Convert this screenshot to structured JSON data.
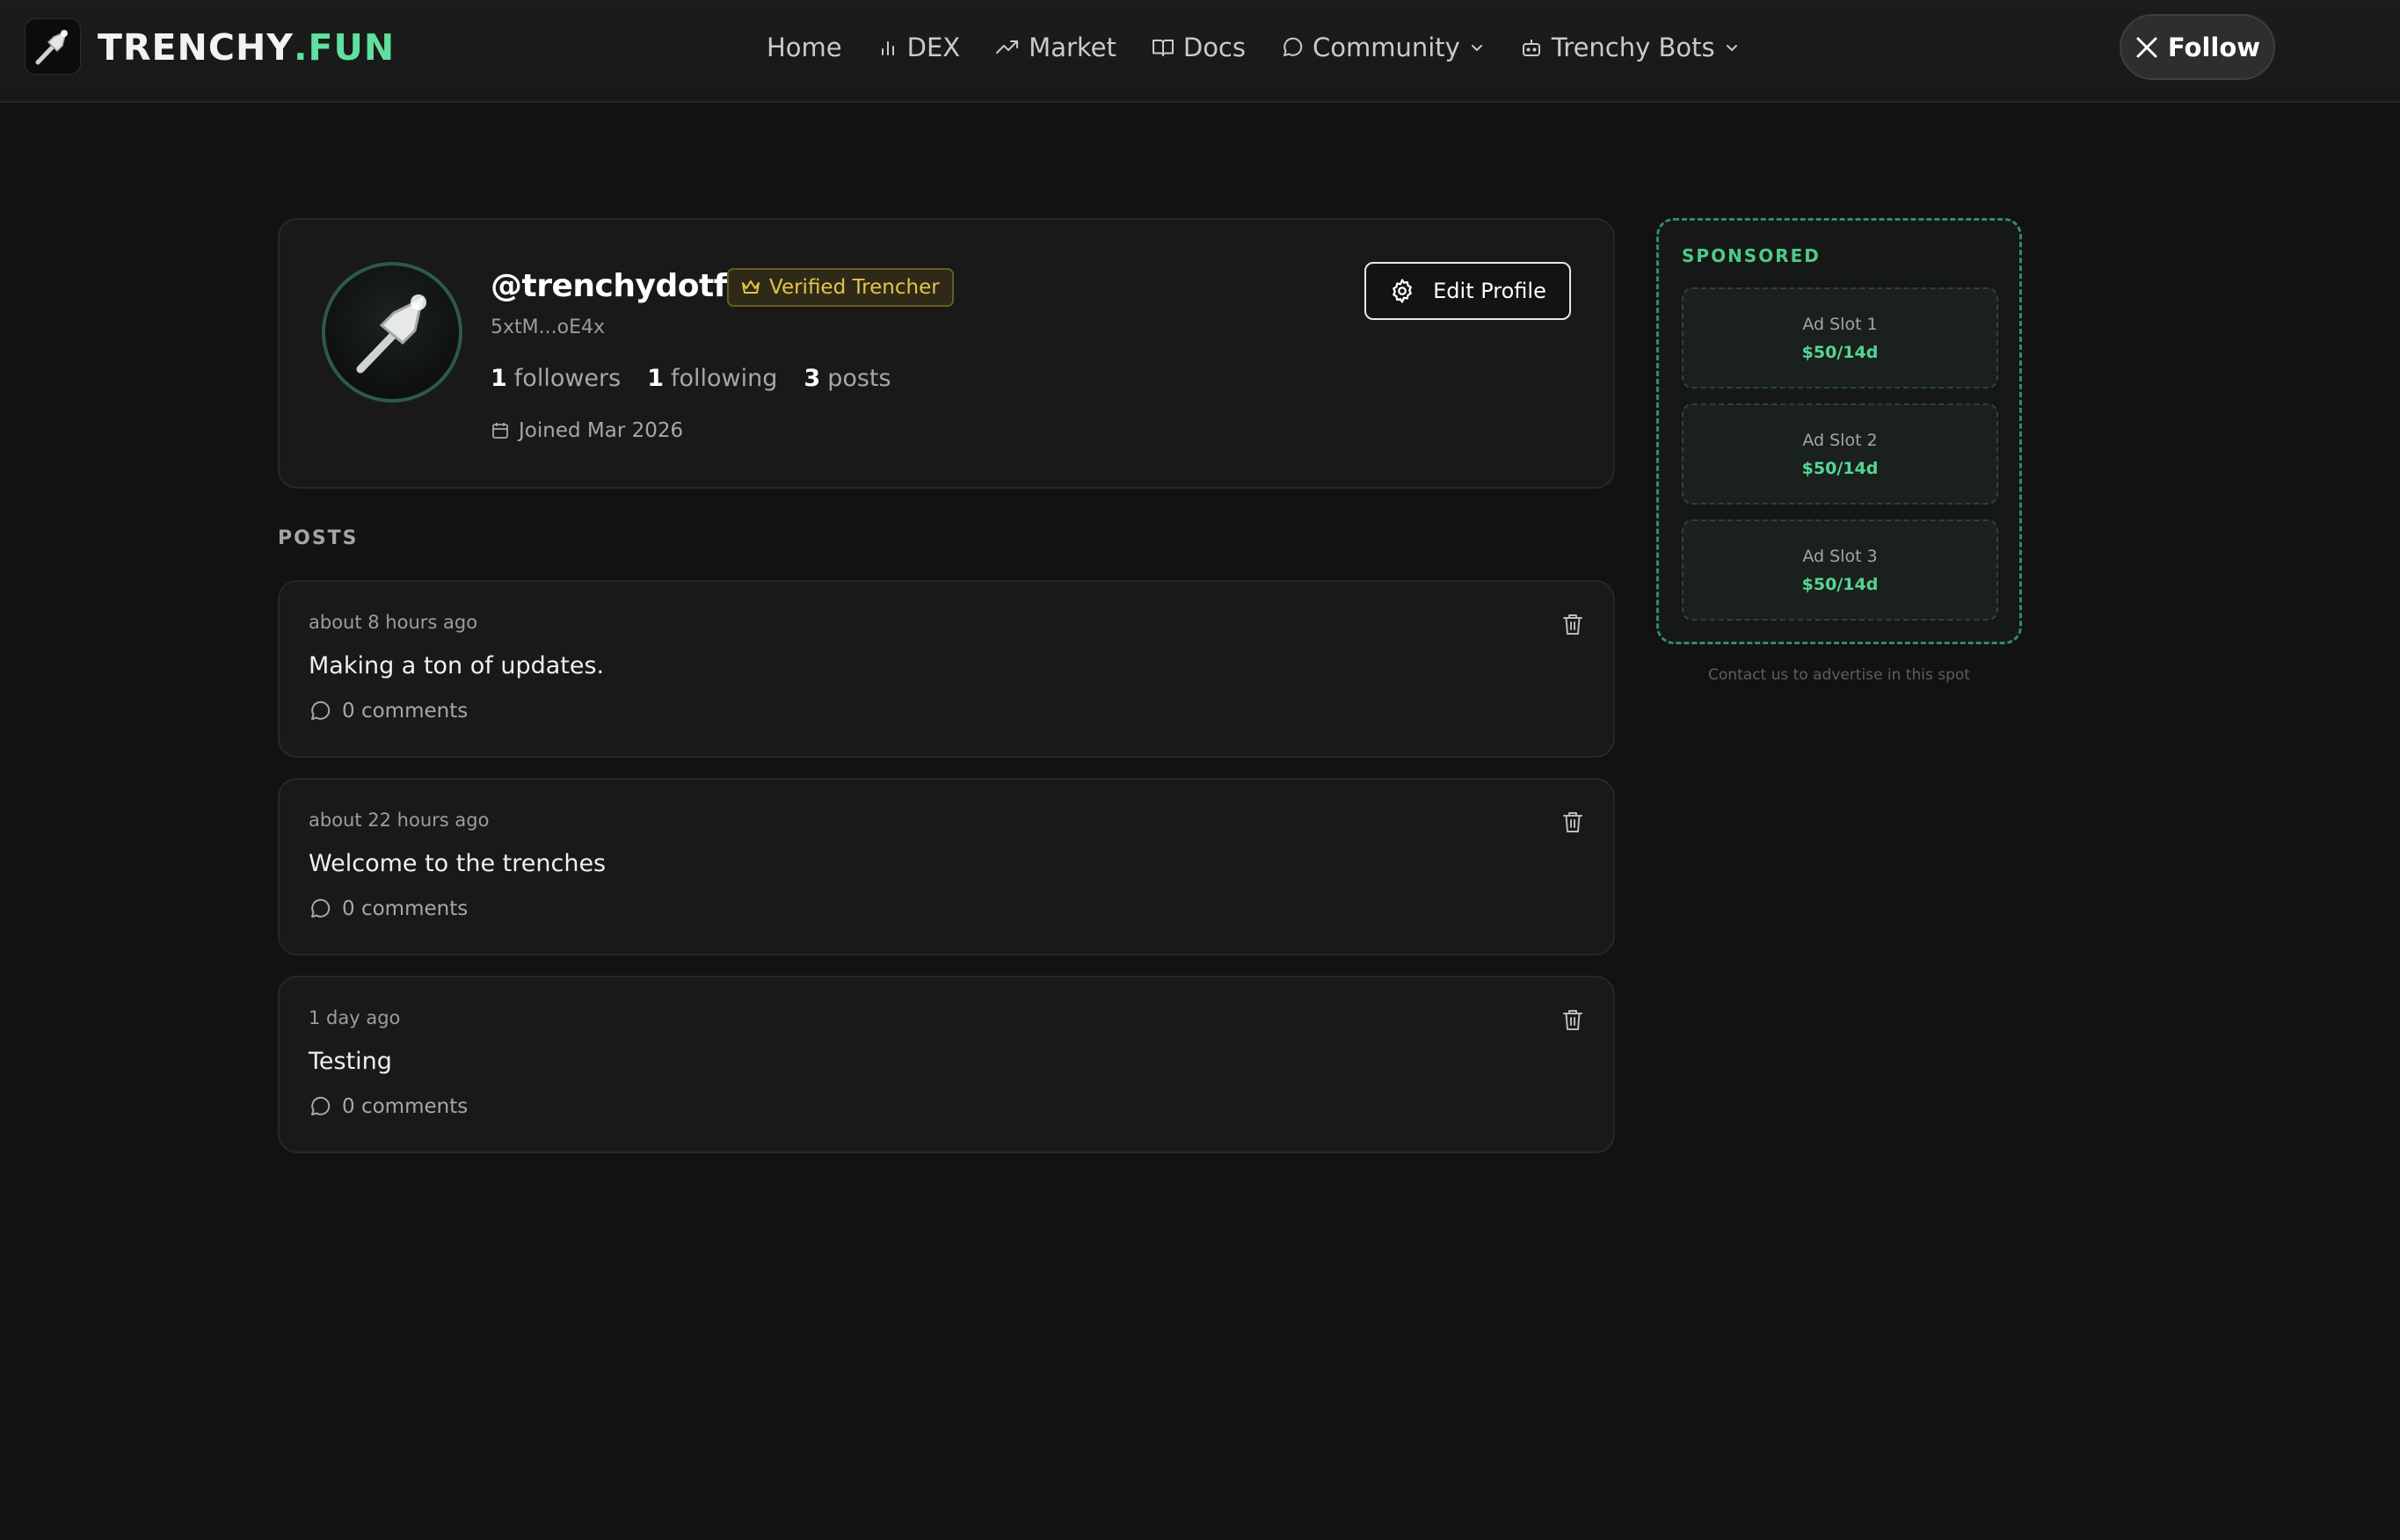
{
  "nav": {
    "brand_part1": "TRENCHY",
    "brand_part2": ".FUN",
    "items": [
      {
        "label": "Home",
        "icon": "none"
      },
      {
        "label": "DEX",
        "icon": "bar-chart-icon"
      },
      {
        "label": "Market",
        "icon": "trending-up-icon"
      },
      {
        "label": "Docs",
        "icon": "book-icon"
      },
      {
        "label": "Community",
        "icon": "message-circle-icon",
        "dropdown": true
      },
      {
        "label": "Trenchy Bots",
        "icon": "bot-icon",
        "dropdown": true
      }
    ],
    "follow_label": "Follow"
  },
  "profile": {
    "username": "@trenchydotfun",
    "badge": "Verified Trencher",
    "wallet": "5xtM...oE4x",
    "followers_count": "1",
    "followers_label": "followers",
    "following_count": "1",
    "following_label": "following",
    "posts_count": "3",
    "posts_label": "posts",
    "joined": "Joined Mar 2026",
    "edit_label": "Edit Profile"
  },
  "posts_section": {
    "title": "POSTS",
    "items": [
      {
        "time": "about 8 hours ago",
        "text": "Making a ton of updates.",
        "comments": "0 comments"
      },
      {
        "time": "about 22 hours ago",
        "text": "Welcome to the trenches",
        "comments": "0 comments"
      },
      {
        "time": "1 day ago",
        "text": "Testing",
        "comments": "0 comments"
      }
    ]
  },
  "sponsored": {
    "title": "SPONSORED",
    "slots": [
      {
        "name": "Ad Slot 1",
        "price": "$50/14d"
      },
      {
        "name": "Ad Slot 2",
        "price": "$50/14d"
      },
      {
        "name": "Ad Slot 3",
        "price": "$50/14d"
      }
    ],
    "contact": "Contact us to advertise in this spot"
  },
  "colors": {
    "background": "#121212",
    "accent_green": "#5fe09f",
    "badge_gold": "#e6c34a"
  }
}
